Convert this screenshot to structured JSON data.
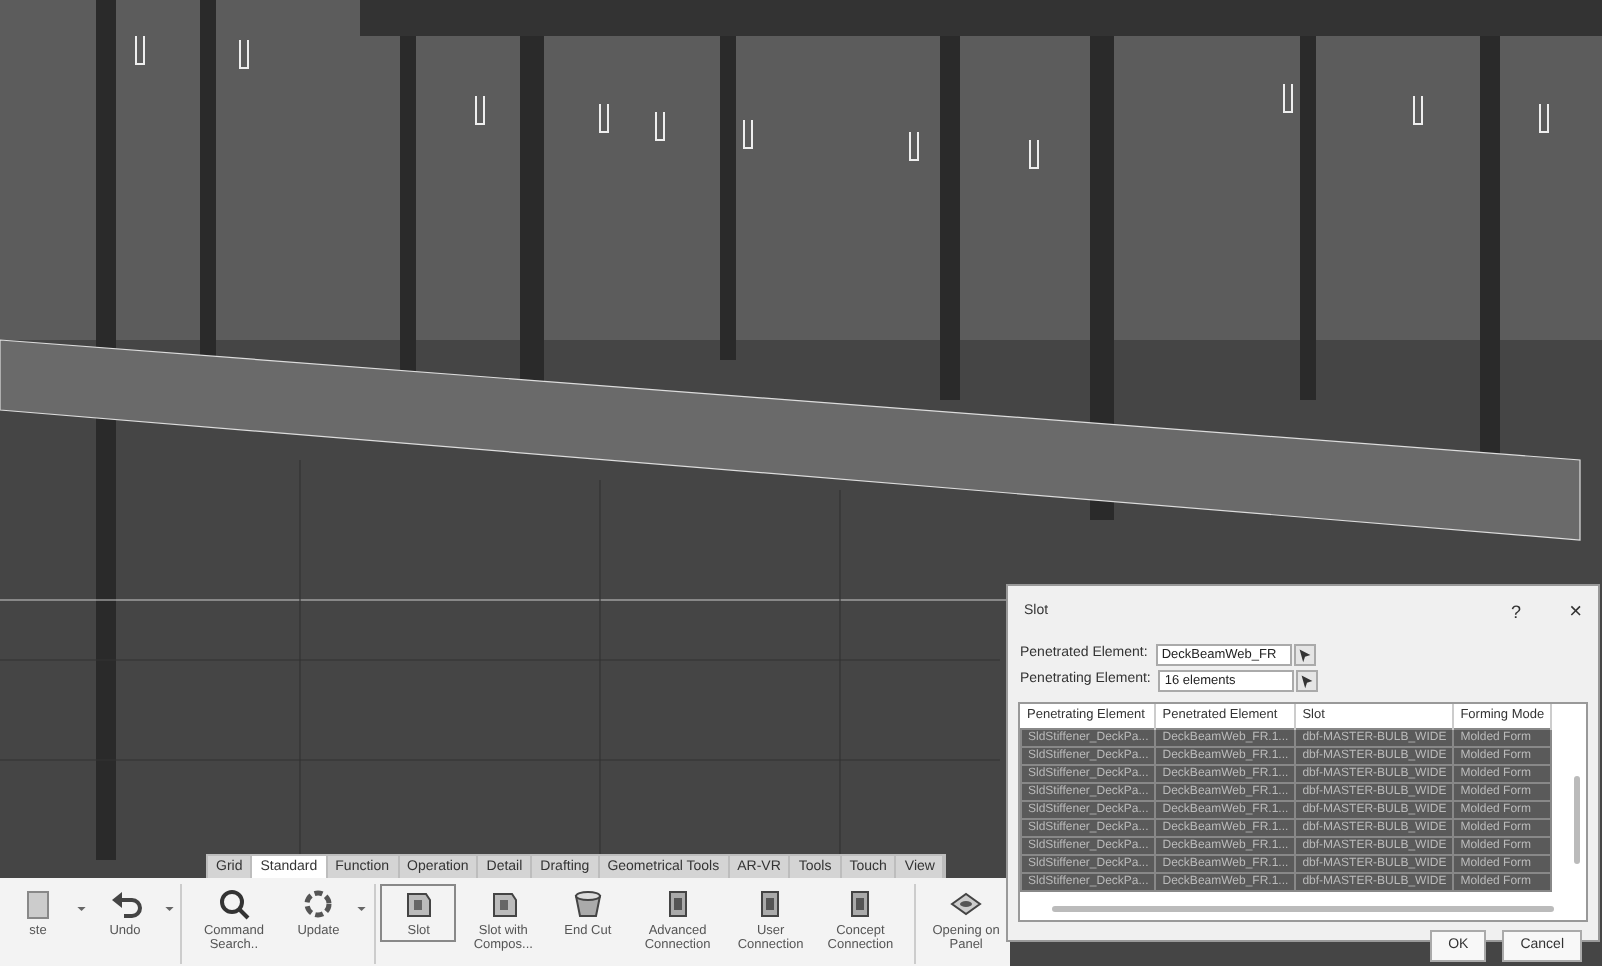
{
  "toolbar_tabs": [
    {
      "label": "Grid",
      "selected": false
    },
    {
      "label": "Standard",
      "selected": true
    },
    {
      "label": "Function",
      "selected": false
    },
    {
      "label": "Operation",
      "selected": false
    },
    {
      "label": "Detail",
      "selected": false
    },
    {
      "label": "Drafting",
      "selected": false
    },
    {
      "label": "Geometrical Tools",
      "selected": false
    },
    {
      "label": "AR-VR",
      "selected": false
    },
    {
      "label": "Tools",
      "selected": false
    },
    {
      "label": "Touch",
      "selected": false
    },
    {
      "label": "View",
      "selected": false
    }
  ],
  "toolbar_buttons": [
    {
      "kind": "paste",
      "label": "ste",
      "dropdown": true,
      "selected": false
    },
    {
      "kind": "undo",
      "label": "Undo",
      "dropdown": true,
      "selected": false
    },
    {
      "kind": "search",
      "label": "Command Search..",
      "dropdown": false,
      "selected": false
    },
    {
      "kind": "update",
      "label": "Update",
      "dropdown": true,
      "selected": false
    },
    {
      "kind": "slot",
      "label": "Slot",
      "dropdown": false,
      "selected": true
    },
    {
      "kind": "slot",
      "label": "Slot with Compos...",
      "dropdown": false,
      "selected": false
    },
    {
      "kind": "cut",
      "label": "End Cut",
      "dropdown": false,
      "selected": false
    },
    {
      "kind": "connection",
      "label": "Advanced Connection",
      "dropdown": false,
      "selected": false
    },
    {
      "kind": "connection",
      "label": "User Connection",
      "dropdown": false,
      "selected": false
    },
    {
      "kind": "connection",
      "label": "Concept Connection",
      "dropdown": false,
      "selected": false
    },
    {
      "kind": "opening",
      "label": "Opening on Panel",
      "dropdown": false,
      "selected": false
    }
  ],
  "dialog": {
    "title": "Slot",
    "help": "?",
    "close": "×",
    "fields": [
      {
        "label": "Penetrated Element:",
        "value": "DeckBeamWeb_FR"
      },
      {
        "label": "Penetrating Element:",
        "value": "16 elements"
      }
    ],
    "table": {
      "columns": [
        "Penetrating Element",
        "Penetrated Element",
        "Slot",
        "Forming Mode"
      ],
      "rows": [
        {
          "cells": [
            "SldStiffener_DeckPa...",
            "DeckBeamWeb_FR.1...",
            "dbf-MASTER-BULB_WIDE",
            "Molded Form"
          ],
          "selected": true
        },
        {
          "cells": [
            "SldStiffener_DeckPa...",
            "DeckBeamWeb_FR.1...",
            "dbf-MASTER-BULB_WIDE",
            "Molded Form"
          ],
          "selected": true
        },
        {
          "cells": [
            "SldStiffener_DeckPa...",
            "DeckBeamWeb_FR.1...",
            "dbf-MASTER-BULB_WIDE",
            "Molded Form"
          ],
          "selected": true
        },
        {
          "cells": [
            "SldStiffener_DeckPa...",
            "DeckBeamWeb_FR.1...",
            "dbf-MASTER-BULB_WIDE",
            "Molded Form"
          ],
          "selected": true
        },
        {
          "cells": [
            "SldStiffener_DeckPa...",
            "DeckBeamWeb_FR.1...",
            "dbf-MASTER-BULB_WIDE",
            "Molded Form"
          ],
          "selected": true
        },
        {
          "cells": [
            "SldStiffener_DeckPa...",
            "DeckBeamWeb_FR.1...",
            "dbf-MASTER-BULB_WIDE",
            "Molded Form"
          ],
          "selected": true
        },
        {
          "cells": [
            "SldStiffener_DeckPa...",
            "DeckBeamWeb_FR.1...",
            "dbf-MASTER-BULB_WIDE",
            "Molded Form"
          ],
          "selected": true
        },
        {
          "cells": [
            "SldStiffener_DeckPa...",
            "DeckBeamWeb_FR.1...",
            "dbf-MASTER-BULB_WIDE",
            "Molded Form"
          ],
          "selected": true
        },
        {
          "cells": [
            "SldStiffener_DeckPa...",
            "DeckBeamWeb_FR.1...",
            "dbf-MASTER-BULB_WIDE",
            "Molded Form"
          ],
          "selected": true
        }
      ]
    },
    "buttons": [
      "OK",
      "Cancel"
    ]
  }
}
